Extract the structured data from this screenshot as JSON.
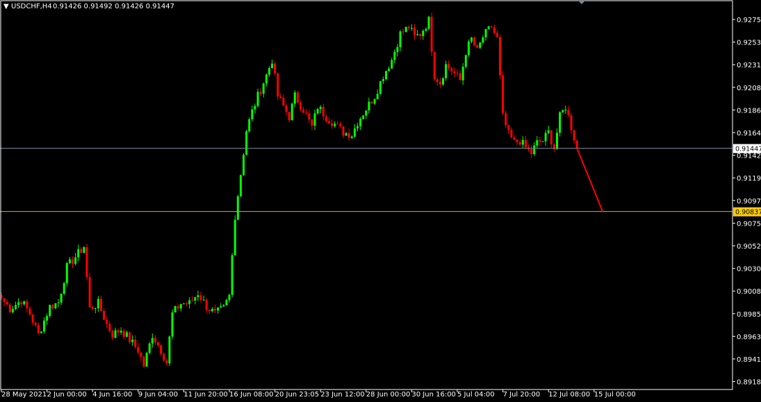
{
  "header": {
    "menu_glyph": "▼",
    "symbol_timeframe": "USDCHF,H4",
    "ohlc_text": "0.91426 0.91492 0.91426 0.91447"
  },
  "colors": {
    "background": "#000000",
    "frame": "#ffffff",
    "bull_candle": "#00ff00",
    "bear_candle": "#ff0000",
    "bid_line": "#778899",
    "level_line": "#ffa500",
    "level_tag": "#ffcc00",
    "projection_line": "#ff0000",
    "marker": "#778899"
  },
  "chart_data": {
    "type": "candlestick",
    "symbol": "USDCHF",
    "timeframe": "H4",
    "grid": false,
    "ylim": [
      0.8912,
      0.9287
    ],
    "price_axis_labels": [
      "0.92755",
      "0.92535",
      "0.92310",
      "0.92085",
      "0.91865",
      "0.91640",
      "0.91420",
      "0.91195",
      "0.90970",
      "0.90750",
      "0.90525",
      "0.90300",
      "0.90080",
      "0.89855",
      "0.89630",
      "0.89410",
      "0.89185"
    ],
    "time_axis_labels": [
      "28 May 2021",
      "2 Jun 00:00",
      "4 Jun 16:00",
      "9 Jun 04:00",
      "11 Jun 20:00",
      "16 Jun 08:00",
      "20 Jun 23:05",
      "23 Jun 12:00",
      "28 Jun 00:00",
      "30 Jun 16:00",
      "5 Jul 04:00",
      "7 Jul 20:00",
      "12 Jul 08:00",
      "15 Jul 00:00"
    ],
    "bars_per_label": 16,
    "current_bid": {
      "value": 0.91447,
      "label": "0.91447"
    },
    "horizontal_level": {
      "value": 0.90837,
      "label": "0.90837"
    },
    "projection_line": {
      "from_bar": 202,
      "from_price": 0.91447,
      "to_bar": 211,
      "to_price": 0.90837
    },
    "price_path": [
      [
        0,
        0.9
      ],
      [
        3,
        0.899
      ],
      [
        7,
        0.8998
      ],
      [
        10,
        0.8985
      ],
      [
        13,
        0.8965
      ],
      [
        17,
        0.8992
      ],
      [
        20,
        0.8996
      ],
      [
        23,
        0.903
      ],
      [
        26,
        0.904
      ],
      [
        29,
        0.905
      ],
      [
        31,
        0.899
      ],
      [
        34,
        0.8995
      ],
      [
        37,
        0.8975
      ],
      [
        39,
        0.8965
      ],
      [
        42,
        0.897
      ],
      [
        45,
        0.896
      ],
      [
        48,
        0.895
      ],
      [
        50,
        0.8935
      ],
      [
        53,
        0.8965
      ],
      [
        56,
        0.895
      ],
      [
        58,
        0.8938
      ],
      [
        60,
        0.8985
      ],
      [
        63,
        0.8995
      ],
      [
        66,
        0.8995
      ],
      [
        69,
        0.9005
      ],
      [
        72,
        0.8992
      ],
      [
        75,
        0.8985
      ],
      [
        78,
        0.899
      ],
      [
        80,
        0.9002
      ],
      [
        82,
        0.908
      ],
      [
        84,
        0.912
      ],
      [
        86,
        0.9162
      ],
      [
        88,
        0.918
      ],
      [
        90,
        0.9195
      ],
      [
        93,
        0.9215
      ],
      [
        95,
        0.923
      ],
      [
        97,
        0.9195
      ],
      [
        99,
        0.9185
      ],
      [
        101,
        0.9175
      ],
      [
        103,
        0.9195
      ],
      [
        106,
        0.9182
      ],
      [
        109,
        0.9165
      ],
      [
        111,
        0.9185
      ],
      [
        114,
        0.9175
      ],
      [
        117,
        0.9168
      ],
      [
        120,
        0.916
      ],
      [
        123,
        0.9158
      ],
      [
        125,
        0.917
      ],
      [
        128,
        0.9183
      ],
      [
        131,
        0.9195
      ],
      [
        134,
        0.9215
      ],
      [
        137,
        0.923
      ],
      [
        140,
        0.9255
      ],
      [
        143,
        0.9262
      ],
      [
        145,
        0.9252
      ],
      [
        147,
        0.9255
      ],
      [
        150,
        0.9268
      ],
      [
        152,
        0.9215
      ],
      [
        154,
        0.9208
      ],
      [
        156,
        0.9225
      ],
      [
        158,
        0.922
      ],
      [
        161,
        0.921
      ],
      [
        163,
        0.9238
      ],
      [
        165,
        0.925
      ],
      [
        167,
        0.9238
      ],
      [
        169,
        0.9252
      ],
      [
        172,
        0.9262
      ],
      [
        174,
        0.925
      ],
      [
        176,
        0.9175
      ],
      [
        178,
        0.9158
      ],
      [
        180,
        0.915
      ],
      [
        182,
        0.9152
      ],
      [
        184,
        0.9145
      ],
      [
        186,
        0.914
      ],
      [
        188,
        0.915
      ],
      [
        190,
        0.9152
      ],
      [
        192,
        0.916
      ],
      [
        194,
        0.9145
      ],
      [
        196,
        0.9175
      ],
      [
        198,
        0.9185
      ],
      [
        200,
        0.9165
      ],
      [
        202,
        0.91447
      ]
    ]
  }
}
